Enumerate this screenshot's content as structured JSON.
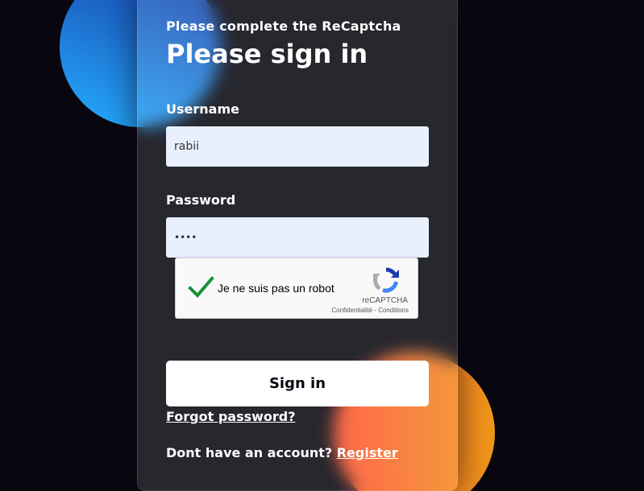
{
  "header": {
    "subtitle": "Please complete the ReCaptcha",
    "title": "Please sign in"
  },
  "form": {
    "username_label": "Username",
    "username_value": "rabii",
    "password_label": "Password",
    "password_value": "••••"
  },
  "recaptcha": {
    "label": "Je ne suis pas un robot",
    "brand": "reCAPTCHA",
    "privacy": "Confidentialité",
    "separator": " - ",
    "terms": "Conditions",
    "checked": true,
    "check_color": "#1a8f3c"
  },
  "actions": {
    "signin_label": "Sign in",
    "forgot_label": "Forgot password?",
    "no_account_text": "Dont have an account?",
    "register_label": "Register"
  },
  "colors": {
    "background": "#080710",
    "blob_blue_start": "#1845ad",
    "blob_blue_end": "#23a2f6",
    "blob_orange_start": "#ff512f",
    "blob_orange_end": "#f09819",
    "input_background": "#e8f0fe"
  }
}
